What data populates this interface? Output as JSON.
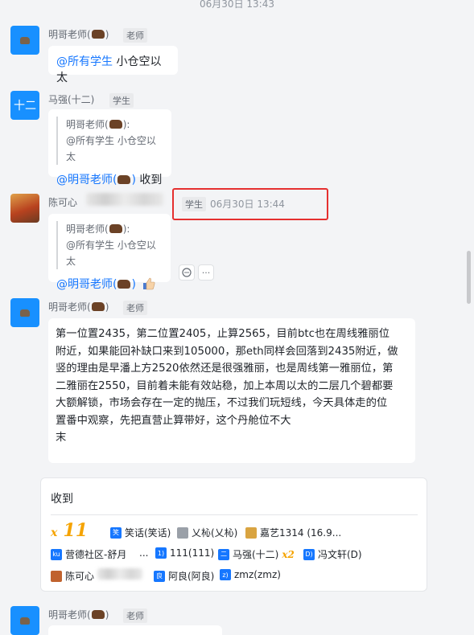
{
  "top_timestamp": "06月30日 13:43",
  "messages": [
    {
      "sender": "明哥老师(",
      "sender_suffix": ")",
      "role": "老师",
      "mention": "@所有学生",
      "text": " 小仓空以太"
    },
    {
      "avatar_text": "十二",
      "sender": "马强(十二)",
      "role": "学生",
      "quote_line1": "明哥老师(",
      "quote_line1_suffix": "):",
      "quote_line2": "@所有学生 小仓空以太",
      "mention": "@明哥老师(",
      "mention_suffix": ")",
      "text": " 收到"
    },
    {
      "sender": "陈可心",
      "role": "学生",
      "time": "06月30日 13:44",
      "quote_line1": "明哥老师(",
      "quote_line1_suffix": "):",
      "quote_line2": "@所有学生 小仓空以太",
      "mention": "@明哥老师(",
      "mention_suffix": ")",
      "emoji": "thumbs-up",
      "actions": [
        "reply-icon",
        "more-icon"
      ]
    },
    {
      "sender": "明哥老师(",
      "sender_suffix": ")",
      "role": "老师",
      "lines": [
        "第一位置2435，第二位置2405，止算2565，目前btc也在周线雅丽位",
        "附近，如果能回补缺口来到105000，那eth同样会回落到2435附近，做",
        "竖的理由是早潘上方2520依然还是很强雅丽，也是周线第一雅丽位，第",
        "二雅丽在2550，目前着未能有效站稳，加上本周以太的二层几个碧都要",
        "大额解锁，市场会存在一定的抛压，不过我们玩短线，今天具体走的位",
        "置番中观察，先把直营止算带好，这个丹舱位不大",
        "末"
      ]
    }
  ],
  "reaction_card": {
    "title": "收到",
    "count_prefix": "x",
    "count": "11",
    "row1": [
      {
        "icon": "笑",
        "label": "笑话(笑话)"
      },
      {
        "icon": "img",
        "label": "乂杺(乂杺)"
      },
      {
        "icon": "img",
        "label": "嘉艺1314 (16.9..."
      }
    ],
    "row2": [
      {
        "icon": "ku",
        "label": "营德社区-舒月"
      },
      {
        "icon": "dots",
        "label": "..."
      },
      {
        "icon": "1)",
        "label": "111(111)"
      },
      {
        "icon": "二",
        "label": "马强(十二)",
        "badge": "x2"
      },
      {
        "icon": "D)",
        "label": "冯文轩(D)"
      }
    ],
    "row3": [
      {
        "icon": "img",
        "label": "陈可心"
      },
      {
        "icon": "良",
        "label": "阿良(阿良)"
      },
      {
        "icon": "z)",
        "label": "zmz(zmz)"
      }
    ]
  },
  "last_message": {
    "sender": "明哥老师(",
    "sender_suffix": ")",
    "role": "老师"
  },
  "colors": {
    "accent": "#1677ff",
    "highlight": "#e5302f",
    "background": "#f3f4f6"
  }
}
